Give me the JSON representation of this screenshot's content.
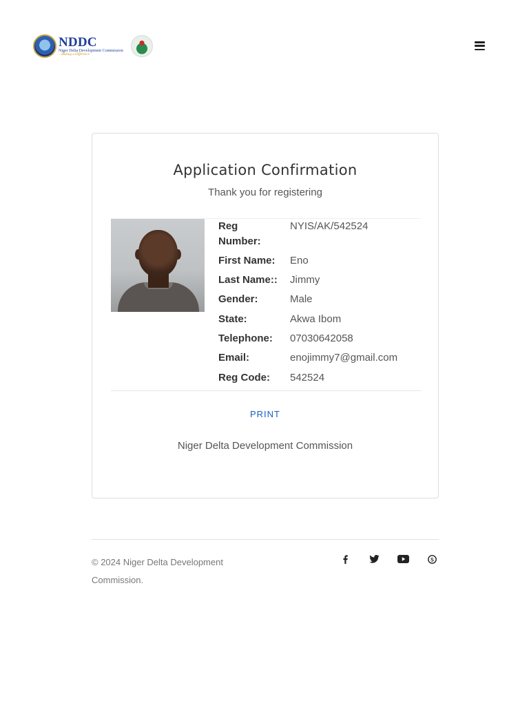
{
  "header": {
    "logo": {
      "main_text": "NDDC",
      "sub_text": "Niger Delta Development Commission",
      "tagline": "...Making a Difference"
    },
    "menu_icon": "hamburger-icon"
  },
  "card": {
    "title": "Application Confirmation",
    "subtitle": "Thank you for registering",
    "fields": [
      {
        "label": "Reg Number:",
        "value": "NYIS/AK/542524"
      },
      {
        "label": "First Name:",
        "value": "Eno"
      },
      {
        "label": "Last Name::",
        "value": "Jimmy"
      },
      {
        "label": "Gender:",
        "value": "Male"
      },
      {
        "label": "State:",
        "value": "Akwa Ibom"
      },
      {
        "label": "Telephone:",
        "value": "07030642058"
      },
      {
        "label": "Email:",
        "value": "enojimmy7@gmail.com"
      },
      {
        "label": "Reg Code:",
        "value": "542524"
      }
    ],
    "print_label": "PRINT",
    "footer_text": "Niger Delta Development Commission"
  },
  "footer": {
    "copyright": "© 2024 Niger Delta Development Commission.",
    "social": [
      "facebook-icon",
      "twitter-icon",
      "youtube-icon",
      "skype-icon"
    ]
  },
  "colors": {
    "link": "#1a5fc2",
    "text": "#555555",
    "heading": "#333333",
    "border": "#dddddd"
  }
}
